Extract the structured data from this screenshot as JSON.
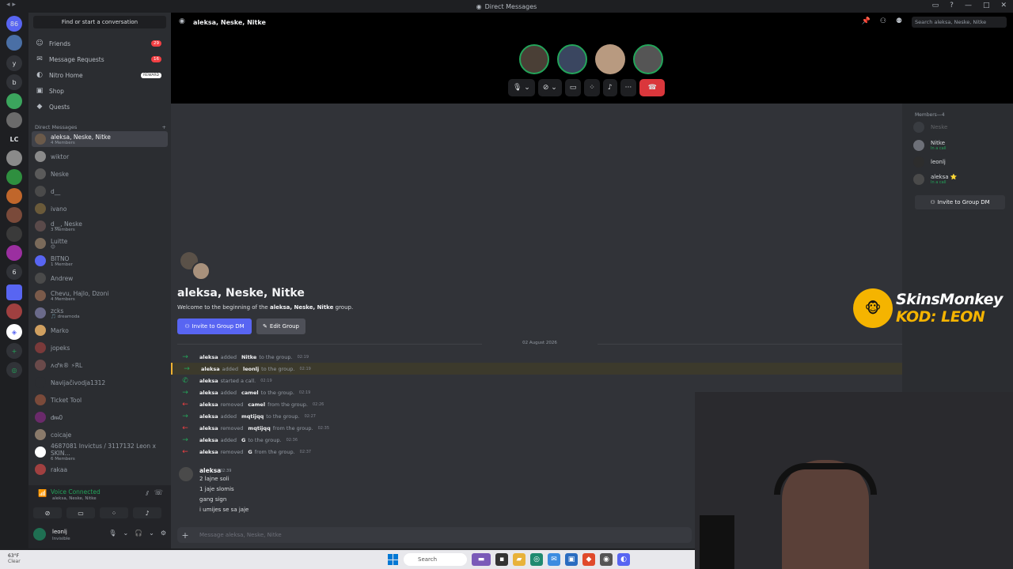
{
  "window": {
    "title": "Direct Messages"
  },
  "colors": {
    "accent": "#5865f2",
    "online": "#23a55a",
    "danger": "#f23f43",
    "highlight": "#f0b232"
  },
  "sidebar": {
    "find_placeholder": "Find or start a conversation",
    "nav": [
      {
        "label": "Friends",
        "icon": "friends-icon",
        "badge": "29"
      },
      {
        "label": "Message Requests",
        "icon": "mail-icon",
        "badge": "16"
      },
      {
        "label": "Nitro Home",
        "icon": "nitro-icon",
        "badge": "REWARD"
      },
      {
        "label": "Shop",
        "icon": "shop-icon",
        "badge": ""
      },
      {
        "label": "Quests",
        "icon": "quests-icon",
        "badge": ""
      }
    ],
    "dm_header": "Direct Messages",
    "dm_add": "+",
    "dms": [
      {
        "name": "aleksa, Neske, Nitke",
        "sub": "4 Members"
      },
      {
        "name": "wiktor",
        "sub": ""
      },
      {
        "name": "Neske",
        "sub": ""
      },
      {
        "name": "d__",
        "sub": ""
      },
      {
        "name": "ivano",
        "sub": ""
      },
      {
        "name": "d__, Neske",
        "sub": "3 Members"
      },
      {
        "name": "Luitte",
        "sub": "😊"
      },
      {
        "name": "BITNO",
        "sub": "1 Member"
      },
      {
        "name": "Andrew",
        "sub": ""
      },
      {
        "name": "Chevu, Hajlo, Dzoni",
        "sub": "4 Members"
      },
      {
        "name": "zcks",
        "sub": "🎵 dreamoda"
      },
      {
        "name": "Marko",
        "sub": ""
      },
      {
        "name": "jopeks",
        "sub": ""
      },
      {
        "name": "ʌ♂ʀ® ⚡RL",
        "sub": ""
      },
      {
        "name": "Navijačivodja1312",
        "sub": ""
      },
      {
        "name": "Ticket Tool",
        "sub": ""
      },
      {
        "name": "ᵭᵯ0",
        "sub": ""
      },
      {
        "name": "coicaje",
        "sub": ""
      },
      {
        "name": "4687081 Invictus / 3117132 Leon x SKIN...",
        "sub": "6 Members"
      },
      {
        "name": "rakaa",
        "sub": ""
      }
    ],
    "voice": {
      "status": "Voice Connected",
      "channel": "aleksa, Neske, Nitke"
    },
    "user": {
      "name": "leonlj",
      "status": "Invisible"
    }
  },
  "rail": {
    "labels": [
      "86",
      "y",
      "b",
      "LC",
      "6"
    ]
  },
  "header": {
    "dm_title": "aleksa, Neske, Nitke",
    "search_placeholder": "Search aleksa, Neske, Nitke"
  },
  "chat": {
    "group_title": "aleksa, Neske, Nitke",
    "welcome_prefix": "Welcome to the beginning of the",
    "welcome_group": "aleksa, Neske, Nitke",
    "welcome_suffix": "group.",
    "invite_label": "Invite to Group DM",
    "edit_label": "Edit Group",
    "date": "02 August 2026",
    "system_messages": [
      {
        "kind": "add",
        "actor": "aleksa",
        "verb": "added",
        "target": "Nitke",
        "rest": "to the group.",
        "time": "02:19"
      },
      {
        "kind": "add",
        "actor": "aleksa",
        "verb": "added",
        "target": "leonlj",
        "rest": "to the group.",
        "time": "02:19"
      },
      {
        "kind": "call",
        "actor": "aleksa",
        "verb": "started a call.",
        "target": "",
        "rest": "",
        "time": "02:19"
      },
      {
        "kind": "add",
        "actor": "aleksa",
        "verb": "added",
        "target": "camel",
        "rest": "to the group.",
        "time": "02:19"
      },
      {
        "kind": "rem",
        "actor": "aleksa",
        "verb": "removed",
        "target": "camel",
        "rest": "from the group.",
        "time": "02:26"
      },
      {
        "kind": "add",
        "actor": "aleksa",
        "verb": "added",
        "target": "mqtijqq",
        "rest": "to the group.",
        "time": "02:27"
      },
      {
        "kind": "rem",
        "actor": "aleksa",
        "verb": "removed",
        "target": "mqtijqq",
        "rest": "from the group.",
        "time": "02:35"
      },
      {
        "kind": "add",
        "actor": "aleksa",
        "verb": "added",
        "target": "G",
        "rest": "to the group.",
        "time": "02:36"
      },
      {
        "kind": "rem",
        "actor": "aleksa",
        "verb": "removed",
        "target": "G",
        "rest": "from the group.",
        "time": "02:37"
      }
    ],
    "message": {
      "author": "aleksa",
      "time": "02:39",
      "lines": [
        "2 lajne soli",
        "1 jaje slomis",
        "gang sign",
        "i umijes se sa jaje"
      ]
    },
    "composer_placeholder": "Message aleksa, Neske, Nitke"
  },
  "members": {
    "header": "Members—4",
    "list": [
      {
        "name": "Neske",
        "status": ""
      },
      {
        "name": "Nitke",
        "status": "In a call"
      },
      {
        "name": "leonlj",
        "status": ""
      },
      {
        "name": "aleksa ⭐",
        "status": "In a call"
      }
    ],
    "invite_label": "Invite to Group DM"
  },
  "sponsor": {
    "brand": "SkinsMonkey",
    "code": "KOD: LEON"
  },
  "taskbar": {
    "weather_temp": "63°F",
    "weather_desc": "Clear",
    "search_label": "Search"
  }
}
